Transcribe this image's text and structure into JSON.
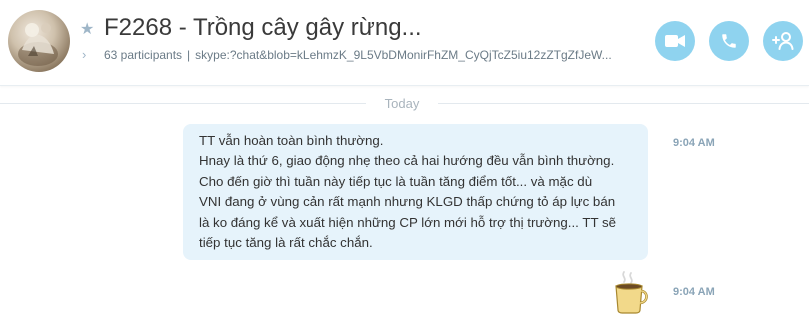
{
  "header": {
    "title": "F2268 - Trồng cây gây rừng...",
    "participants": "63 participants",
    "separator": "|",
    "join_link": "skype:?chat&blob=kLehmzK_9L5VbDMonirFhZM_CyQjTcZ5iu12zZTgZfJeW..."
  },
  "conversation": {
    "day_label": "Today",
    "messages": [
      {
        "lines": [
          "TT vẫn hoàn toàn bình thường.",
          "Hnay là thứ 6, giao động nhẹ theo cả hai hướng đều vẫn bình thường.",
          "Cho đến giờ thì tuần này tiếp tục là tuần tăng điểm tốt... và mặc dù",
          "VNI đang ở vùng cản rất mạnh nhưng KLGD thấp chứng tỏ áp lực bán",
          "là ko đáng kể và xuất hiện những CP lớn mới hỗ trợ thị trường... TT sẽ",
          "tiếp tục tăng là rất chắc chắn."
        ],
        "time": "9:04 AM"
      },
      {
        "emoticon": "coffee-cup-icon",
        "time": "9:04 AM"
      }
    ]
  },
  "colors": {
    "accent_button": "#8fd3ef",
    "bubble_bg": "#e6f3fb",
    "timestamp": "#8aa4b7"
  }
}
